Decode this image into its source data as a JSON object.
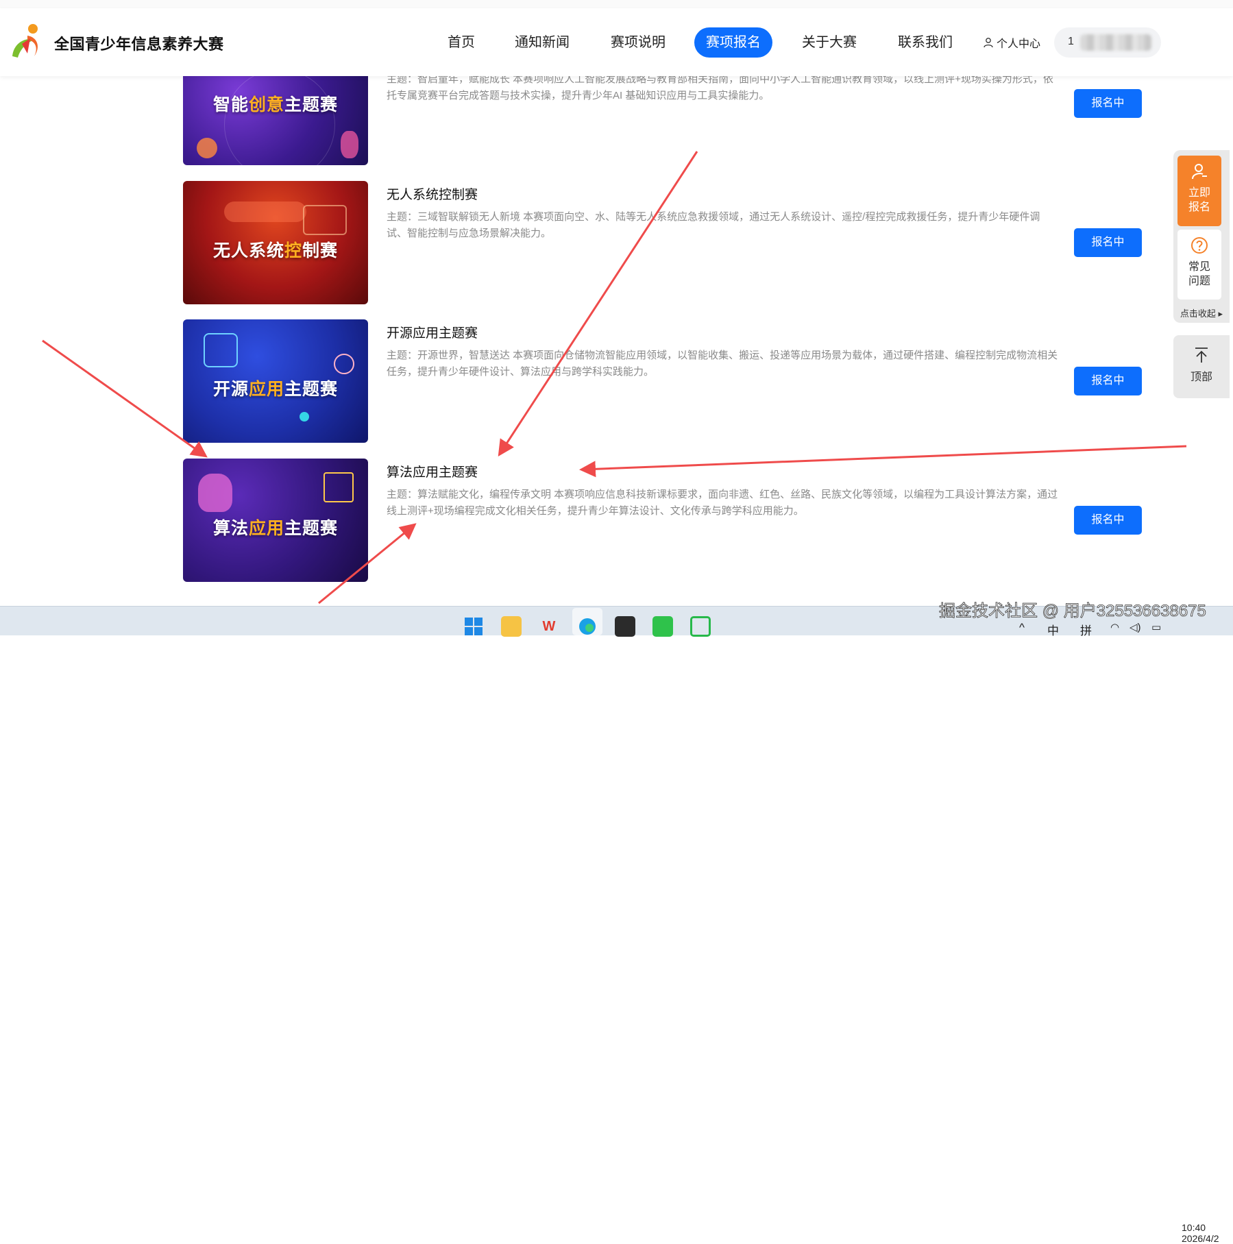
{
  "header": {
    "site_title": "全国青少年信息素养大赛",
    "nav": [
      {
        "label": "首页"
      },
      {
        "label": "通知新闻"
      },
      {
        "label": "赛项说明"
      },
      {
        "label": "赛项报名",
        "active": true
      },
      {
        "label": "关于大赛"
      },
      {
        "label": "联系我们"
      }
    ],
    "user_center_label": "个人中心",
    "phone_visible_prefix": "1",
    "active_color": "#0d6efd"
  },
  "cards": [
    {
      "image_label_pre": "智能",
      "image_label_hl": "创意",
      "image_label_post": "主题赛",
      "title": "",
      "description": "主题：智启童年，赋能成长 本赛项响应人工智能发展战略与教育部相关指南，面向中小学人工智能通识教育领域，以线上测评+现场实操为形式，依托专属竞赛平台完成答题与技术实操，提升青少年AI 基础知识应用与工具实操能力。",
      "button": "报名中"
    },
    {
      "image_label_pre": "无人系统",
      "image_label_hl": "控",
      "image_label_post": "制赛",
      "title": "无人系统控制赛",
      "description": "主题：三域智联解锁无人新境 本赛项面向空、水、陆等无人系统应急救援领域，通过无人系统设计、遥控/程控完成救援任务，提升青少年硬件调试、智能控制与应急场景解决能力。",
      "button": "报名中"
    },
    {
      "image_label_pre": "开源",
      "image_label_hl": "应用",
      "image_label_post": "主题赛",
      "title": "开源应用主题赛",
      "description": "主题：开源世界，智慧送达 本赛项面向仓储物流智能应用领域，以智能收集、搬运、投递等应用场景为载体，通过硬件搭建、编程控制完成物流相关任务，提升青少年硬件设计、算法应用与跨学科实践能力。",
      "button": "报名中"
    },
    {
      "image_label_pre": "算法",
      "image_label_hl": "应用",
      "image_label_post": "主题赛",
      "title": "算法应用主题赛",
      "description": "主题：算法赋能文化，编程传承文明 本赛项响应信息科技新课标要求，面向非遗、红色、丝路、民族文化等领域，以编程为工具设计算法方案，通过线上测评+现场编程完成文化相关任务，提升青少年算法设计、文化传承与跨学科应用能力。",
      "button": "报名中"
    }
  ],
  "side": {
    "signup": "立即报名",
    "faq": "常见问题",
    "collapse": "点击收起",
    "top": "顶部",
    "signup_color": "#f5822a"
  },
  "taskbar": {
    "tray_expand": "^",
    "ime_lang": "中",
    "ime_mode": "拼",
    "time": "10:40",
    "date": "2026/4/2"
  },
  "watermark": "掘金技术社区 @ 用户325536638675",
  "annotation_color": "#ef4b4b"
}
